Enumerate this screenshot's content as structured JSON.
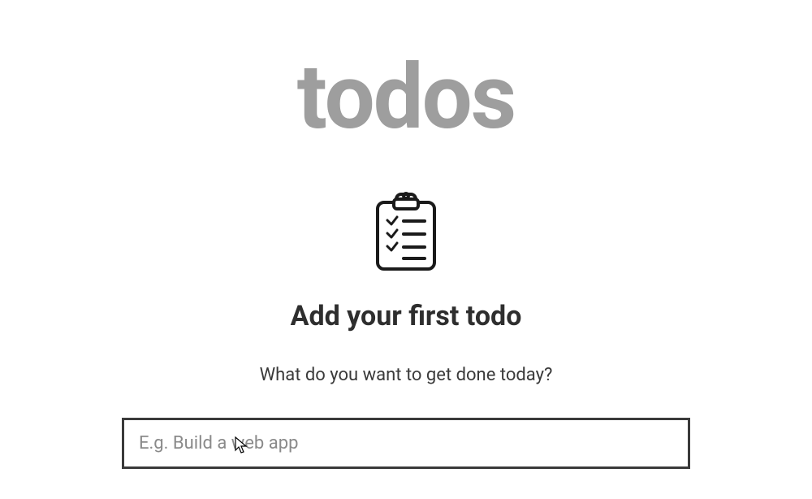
{
  "header": {
    "title": "todos"
  },
  "empty_state": {
    "icon": "clipboard-checklist-icon",
    "heading": "Add your first todo",
    "subheading": "What do you want to get done today?"
  },
  "input": {
    "placeholder": "E.g. Build a web app",
    "value": ""
  }
}
